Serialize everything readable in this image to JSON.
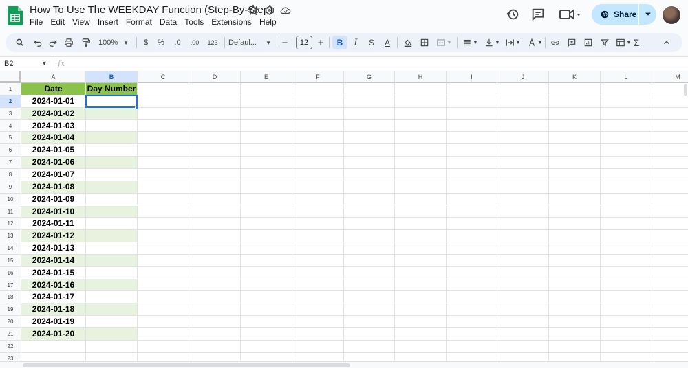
{
  "document": {
    "title": "How To Use The WEEKDAY Function (Step-By-Step)"
  },
  "menu": [
    "File",
    "Edit",
    "View",
    "Insert",
    "Format",
    "Data",
    "Tools",
    "Extensions",
    "Help"
  ],
  "share": {
    "label": "Share"
  },
  "toolbar": {
    "zoom": "100%",
    "currency": "$",
    "percent": "%",
    "decrease_decimal": ".0",
    "increase_decimal": ".00",
    "more_formats": "123",
    "font": "Defaul...",
    "font_size": "12",
    "minus": "−",
    "plus": "+",
    "bold": "B",
    "italic": "I",
    "strikethrough": "S",
    "text_color": "A",
    "sum": "Σ"
  },
  "formula_bar": {
    "name_box": "B2",
    "fx": "fx",
    "content": ""
  },
  "sheet": {
    "columns": [
      "A",
      "B",
      "C",
      "D",
      "E",
      "F",
      "G",
      "H",
      "I",
      "J",
      "K",
      "L",
      "M"
    ],
    "selected_column": "B",
    "selected_row": 2,
    "header_row": [
      "Date",
      "Day Number"
    ],
    "dates": [
      "2024-01-01",
      "2024-01-02",
      "2024-01-03",
      "2024-01-04",
      "2024-01-05",
      "2024-01-06",
      "2024-01-07",
      "2024-01-08",
      "2024-01-09",
      "2024-01-10",
      "2024-01-11",
      "2024-01-12",
      "2024-01-13",
      "2024-01-14",
      "2024-01-15",
      "2024-01-16",
      "2024-01-17",
      "2024-01-18",
      "2024-01-19",
      "2024-01-20"
    ],
    "row_numbers": [
      "1",
      "2",
      "3",
      "4",
      "5",
      "6",
      "7",
      "8",
      "9",
      "10",
      "11",
      "12",
      "13",
      "14",
      "15",
      "16",
      "17",
      "18",
      "19",
      "20",
      "21",
      "22",
      "23"
    ]
  },
  "colors": {
    "header_fill": "#8bc34a",
    "band_fill": "#e8f3df",
    "selection": "#1a73e8",
    "share_bg": "#c2e7ff"
  },
  "icons": [
    "sheets-logo",
    "star-icon",
    "move-to-folder-icon",
    "cloud-saved-icon",
    "history-icon",
    "comment-icon",
    "video-call-icon",
    "globe-icon",
    "search-icon",
    "undo-icon",
    "redo-icon",
    "print-icon",
    "paint-format-icon",
    "fill-color-icon",
    "borders-icon",
    "merge-icon",
    "align-icon",
    "valign-icon",
    "wrap-icon",
    "rotate-icon",
    "link-icon",
    "add-comment-icon",
    "chart-icon",
    "filter-icon",
    "filter-views-icon",
    "collapse-icon"
  ]
}
